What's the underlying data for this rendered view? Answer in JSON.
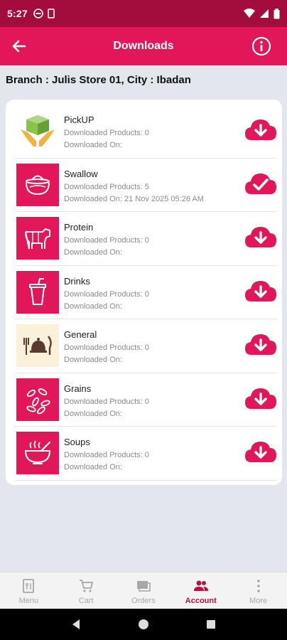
{
  "status_bar": {
    "time": "5:27"
  },
  "app_bar": {
    "title": "Downloads"
  },
  "branch": {
    "text": "Branch : Julis Store 01, City : Ibadan"
  },
  "downloaded_products_label": "Downloaded Products:",
  "downloaded_on_label": "Downloaded On:",
  "categories": [
    {
      "name": "PickUP",
      "products": "Downloaded Products: 0",
      "on": "Downloaded On:",
      "icon": "hands-box-icon",
      "status": "download"
    },
    {
      "name": "Swallow",
      "products": "Downloaded Products: 5",
      "on": "Downloaded On: 21 Nov 2025 05:26 AM",
      "icon": "bowl-icon",
      "status": "done"
    },
    {
      "name": "Protein",
      "products": "Downloaded Products: 0",
      "on": "Downloaded On:",
      "icon": "cow-icon",
      "status": "download"
    },
    {
      "name": "Drinks",
      "products": "Downloaded Products: 0",
      "on": "Downloaded On:",
      "icon": "cup-icon",
      "status": "download"
    },
    {
      "name": "General",
      "products": "Downloaded Products: 0",
      "on": "Downloaded On:",
      "icon": "cloche-icon",
      "status": "download"
    },
    {
      "name": "Grains",
      "products": "Downloaded Products: 0",
      "on": "Downloaded On:",
      "icon": "grains-icon",
      "status": "download"
    },
    {
      "name": "Soups",
      "products": "Downloaded Products: 0",
      "on": "Downloaded On:",
      "icon": "soup-icon",
      "status": "download"
    }
  ],
  "bottom_nav": [
    {
      "label": "Menu",
      "icon": "menu-icon",
      "active": false
    },
    {
      "label": "Cart",
      "icon": "cart-icon",
      "active": false
    },
    {
      "label": "Orders",
      "icon": "orders-icon",
      "active": false
    },
    {
      "label": "Account",
      "icon": "account-icon",
      "active": true
    },
    {
      "label": "More",
      "icon": "more-icon",
      "active": false
    }
  ],
  "colors": {
    "primary": "#e1175a",
    "status_bar": "#a30d3d",
    "active_nav": "#b5123f"
  }
}
